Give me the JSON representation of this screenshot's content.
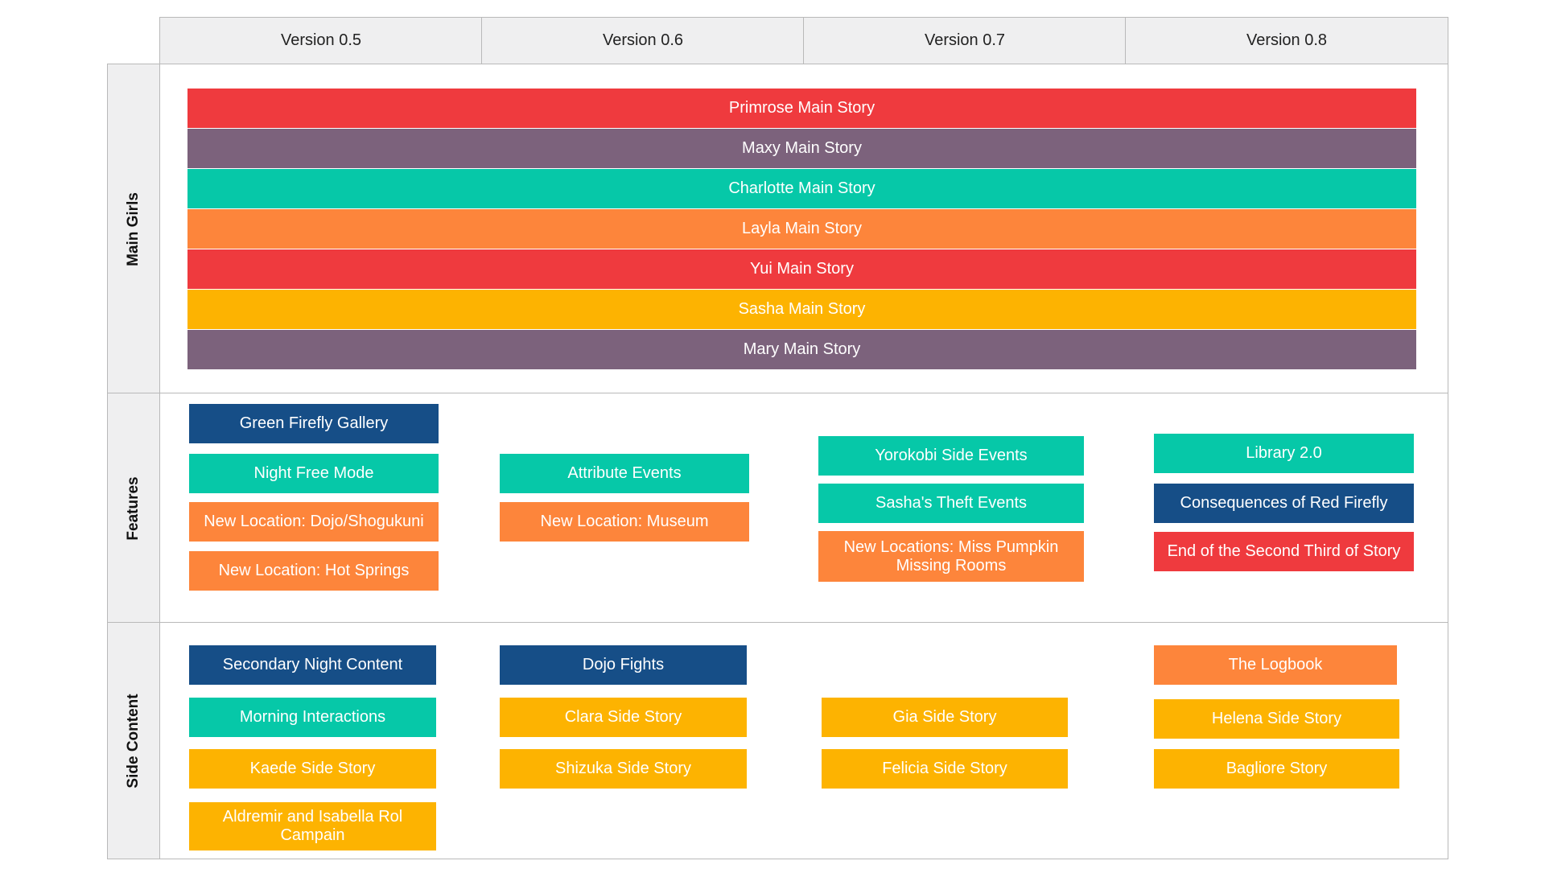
{
  "columns": [
    "Version 0.5",
    "Version 0.6",
    "Version 0.7",
    "Version 0.8"
  ],
  "rows": [
    "Main Girls",
    "Features",
    "Side Content"
  ],
  "colors": {
    "red": "#ef3a3e",
    "purple": "#7c627c",
    "teal": "#06c8a8",
    "orange": "#fd853b",
    "yellow": "#fdb301",
    "navy": "#164e87"
  },
  "main_girls": [
    "Primrose Main Story",
    "Maxy Main Story",
    "Charlotte Main Story",
    "Layla Main Story",
    "Yui Main Story",
    "Sasha Main Story",
    "Mary Main Story"
  ],
  "features": {
    "v05": [
      "Green Firefly Gallery",
      "Night Free Mode",
      "New Location: Dojo/Shogukuni",
      "New Location: Hot Springs"
    ],
    "v06": [
      "Attribute Events",
      "New Location: Museum"
    ],
    "v07": [
      "Yorokobi Side Events",
      "Sasha's Theft Events",
      "New Locations: Miss Pumpkin Missing Rooms"
    ],
    "v08": [
      "Library 2.0",
      "Consequences of Red Firefly",
      "End of the Second Third of Story"
    ]
  },
  "side_content": {
    "v05": [
      "Secondary Night Content",
      "Morning Interactions",
      "Kaede Side Story",
      "Aldremir and Isabella Rol Campain"
    ],
    "v06": [
      "Dojo Fights",
      "Clara Side Story",
      "Shizuka Side Story"
    ],
    "v07": [
      "Gia Side Story",
      "Felicia Side Story"
    ],
    "v08": [
      "The Logbook",
      "Helena Side Story",
      "Bagliore Story"
    ]
  }
}
